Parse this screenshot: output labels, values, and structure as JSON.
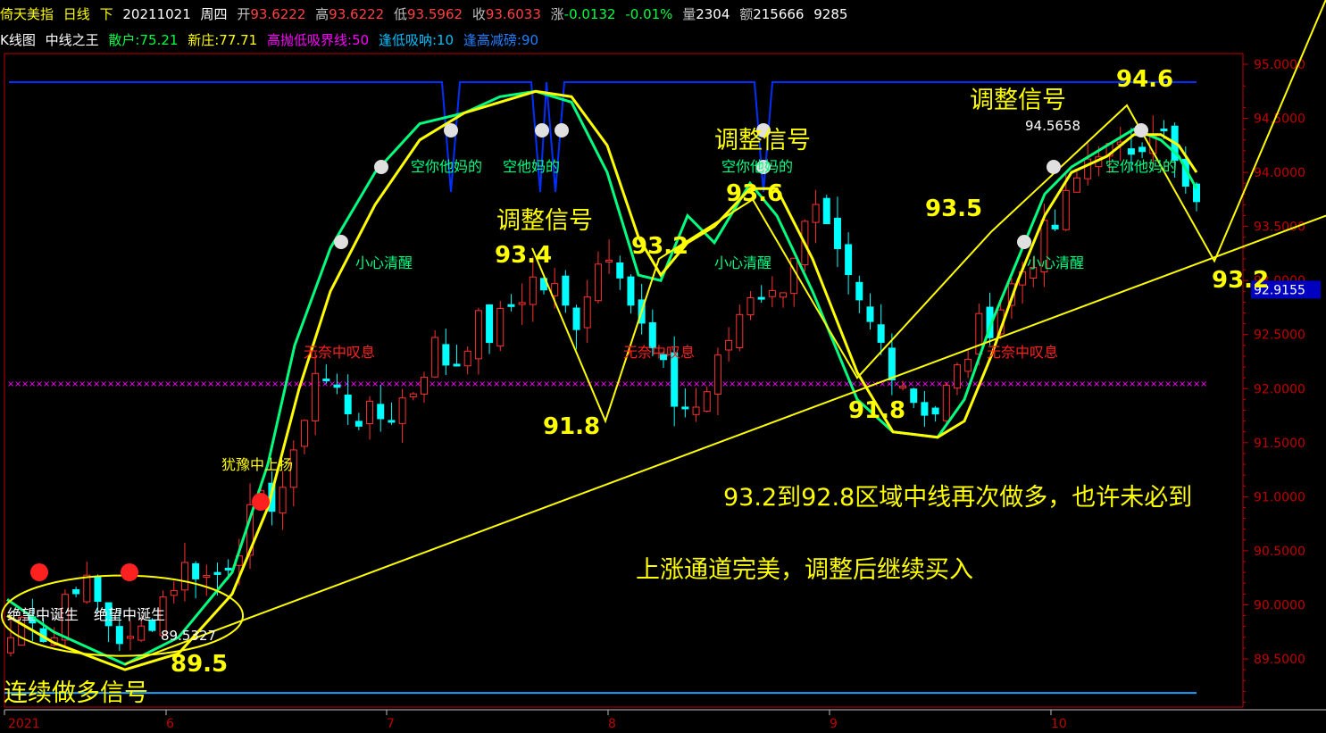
{
  "header": {
    "name": "倚天美指",
    "period": "日线",
    "period_suffix": "下",
    "date": "20211021",
    "weekday": "周四",
    "open_label": "开",
    "open": "93.6222",
    "high_label": "高",
    "high": "93.6222",
    "low_label": "低",
    "low": "93.5962",
    "close_label": "收",
    "close": "93.6033",
    "change_label": "涨",
    "change": "-0.0132",
    "change_pct": "-0.01%",
    "vol_label": "量",
    "vol": "2304",
    "amt_label": "额",
    "amt": "215666",
    "extra": "9285"
  },
  "indicator_bar": {
    "chart_type": "K线图",
    "indicator_name": "中线之王",
    "retail_label": "散户:",
    "retail": "75.21",
    "newbanker_label": "新庄:",
    "newbanker": "77.71",
    "sellbuy_label": "高抛低吸界线:",
    "sellbuy": "50",
    "lowbuy_label": "逢低吸呐:",
    "lowbuy": "10",
    "highreduce_label": "逢高减磅:",
    "highreduce": "90"
  },
  "colors": {
    "up": "#ff3030",
    "down": "#00ffff",
    "green_line": "#00ff80",
    "yellow_line": "#ffff00",
    "blue_line": "#0030ff",
    "magenta": "#ff00ff",
    "axis": "#c00000",
    "annotation": "#ffff00"
  },
  "chart_data": {
    "type": "candlestick",
    "ylim": [
      89.3,
      95.2
    ],
    "y_ticks": [
      "95.0000",
      "94.5000",
      "94.0000",
      "93.5000",
      "93.0000",
      "92.5000",
      "92.0000",
      "91.5000",
      "91.0000",
      "90.5000",
      "90.0000",
      "89.5000"
    ],
    "x_ticks": [
      "2021",
      "6",
      "7",
      "8",
      "9",
      "10"
    ],
    "current_price_label": "92.9155",
    "anchor_closes": [
      89.7,
      90.0,
      89.6,
      90.3,
      90.1,
      89.8,
      89.6,
      89.9,
      90.2,
      90.4,
      90.2,
      90.5,
      90.8,
      91.0,
      91.2,
      92.2,
      92.0,
      91.8,
      91.7,
      91.8,
      92.0,
      92.4,
      92.2,
      92.6,
      92.5,
      92.8,
      93.0,
      92.9,
      92.6,
      93.1,
      93.4,
      92.7,
      92.3,
      91.9,
      91.8,
      92.1,
      92.6,
      93.0,
      92.8,
      93.3,
      93.6,
      93.2,
      92.8,
      92.5,
      92.2,
      91.9,
      91.8,
      92.1,
      92.5,
      92.7,
      93.0,
      93.3,
      93.5,
      93.9,
      94.3,
      94.1,
      94.3,
      94.5,
      94.0,
      93.6
    ],
    "xhatch_level": 92.05,
    "blue_bar_level": 89.35,
    "blue_top_level": 94.8,
    "annotations": {
      "signal_1": "调整信号",
      "signal_2": "调整信号",
      "signal_3": "调整信号",
      "p_934": "93.4",
      "p_932_a": "93.2",
      "p_936": "93.6",
      "p_935": "93.5",
      "p_946": "94.6",
      "p_932_b": "93.2",
      "p_918_a": "91.8",
      "p_918_b": "91.8",
      "p_895": "89.5",
      "p_89_5327": "89.5327",
      "p_94_5658": "94.5658",
      "long_signal": "连续做多信号",
      "text_zone": "93.2到92.8区域中线再次做多，也许未必到",
      "text_channel": "上涨通道完美，调整后继续买入",
      "lbl_careful_1": "小心清醒",
      "lbl_careful_2": "小心清醒",
      "lbl_careful_3": "小心清醒",
      "lbl_short_1": "空你他妈的",
      "lbl_short_2": "空他妈的",
      "lbl_short_3": "空你他妈的",
      "lbl_short_4": "空你他妈的",
      "lbl_sigh_1": "无奈中叹息",
      "lbl_sigh_2": "无奈中叹息",
      "lbl_sigh_3": "无奈中叹息",
      "lbl_hesitate": "犹豫中上扬",
      "lbl_hope_1": "绝望中诞生",
      "lbl_hope_2": "绝望中诞生"
    }
  }
}
